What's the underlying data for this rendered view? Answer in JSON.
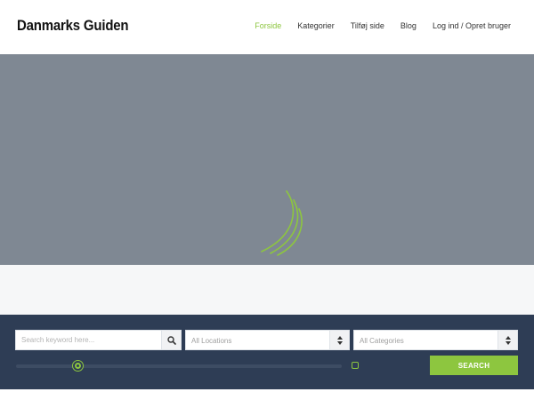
{
  "header": {
    "logo": "Danmarks Guiden",
    "nav": [
      {
        "label": "Forside",
        "active": true
      },
      {
        "label": "Kategorier",
        "active": false
      },
      {
        "label": "Tilføj side",
        "active": false
      },
      {
        "label": "Blog",
        "active": false
      },
      {
        "label": "Log ind / Opret bruger",
        "active": false
      }
    ]
  },
  "search": {
    "keyword_placeholder": "Search keyword here...",
    "location_selected": "All Locations",
    "category_selected": "All Categories",
    "button_label": "SEARCH",
    "radius_slider_fraction": 0.19
  },
  "colors": {
    "accent": "#8dc63f",
    "hero_bg": "#7f8893",
    "search_bg": "#2e3d55"
  }
}
